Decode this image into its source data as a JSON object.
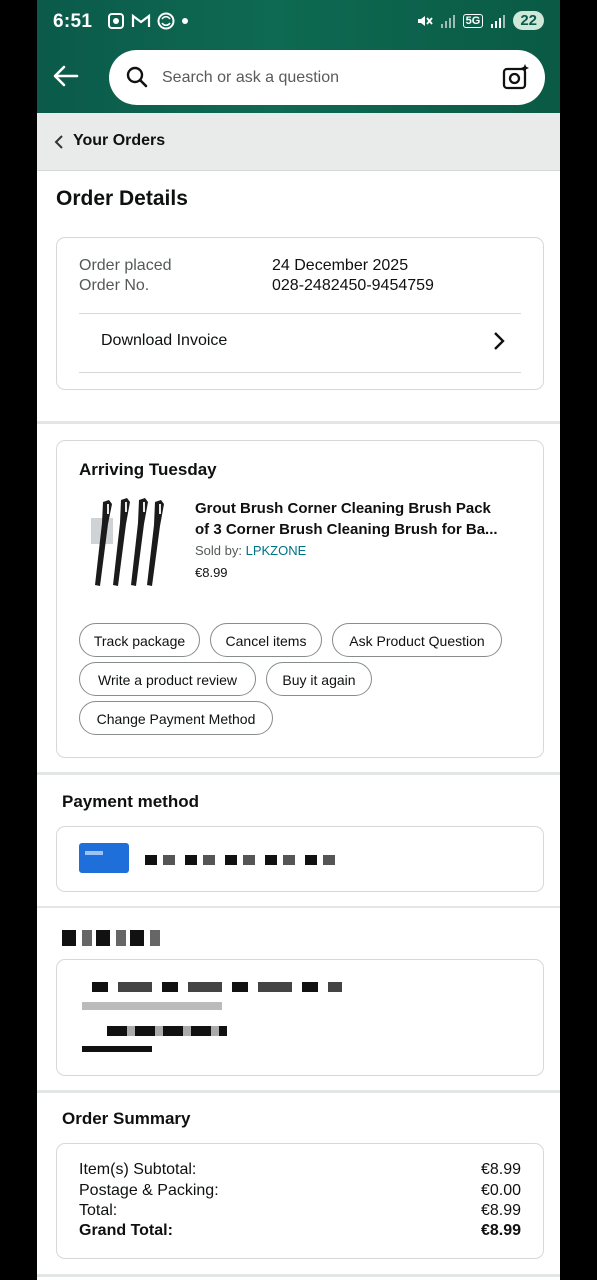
{
  "status_bar": {
    "time": "6:51",
    "battery": "22",
    "network": "5G"
  },
  "search": {
    "placeholder": "Search or ask a question"
  },
  "breadcrumb": {
    "label": "Your Orders"
  },
  "page": {
    "title": "Order Details"
  },
  "order": {
    "placed_label": "Order placed",
    "placed_value": "24 December 2025",
    "number_label": "Order No.",
    "number_value": "028-2482450-9454759",
    "invoice_label": "Download Invoice"
  },
  "shipment": {
    "status": "Arriving Tuesday",
    "product_title_line1": "Grout Brush Corner Cleaning Brush Pack",
    "product_title_line2": "of 3 Corner Brush Cleaning Brush for Ba...",
    "sold_by_label": "Sold by:",
    "seller": "LPKZONE",
    "price": "€8.99",
    "actions": {
      "track": "Track package",
      "cancel": "Cancel items",
      "ask": "Ask Product Question",
      "review": "Write a product review",
      "buy_again": "Buy it again",
      "change_payment": "Change Payment Method"
    }
  },
  "payment": {
    "title": "Payment method"
  },
  "summary": {
    "title": "Order Summary",
    "rows": [
      {
        "label": "Item(s) Subtotal:",
        "value": "€8.99"
      },
      {
        "label": "Postage & Packing:",
        "value": "€0.00"
      },
      {
        "label": "Total:",
        "value": "€8.99"
      },
      {
        "label": "Grand Total:",
        "value": "€8.99"
      }
    ]
  },
  "colors": {
    "header": "#0b5a4a",
    "link": "#007185",
    "card_border": "#d5d9d9"
  }
}
